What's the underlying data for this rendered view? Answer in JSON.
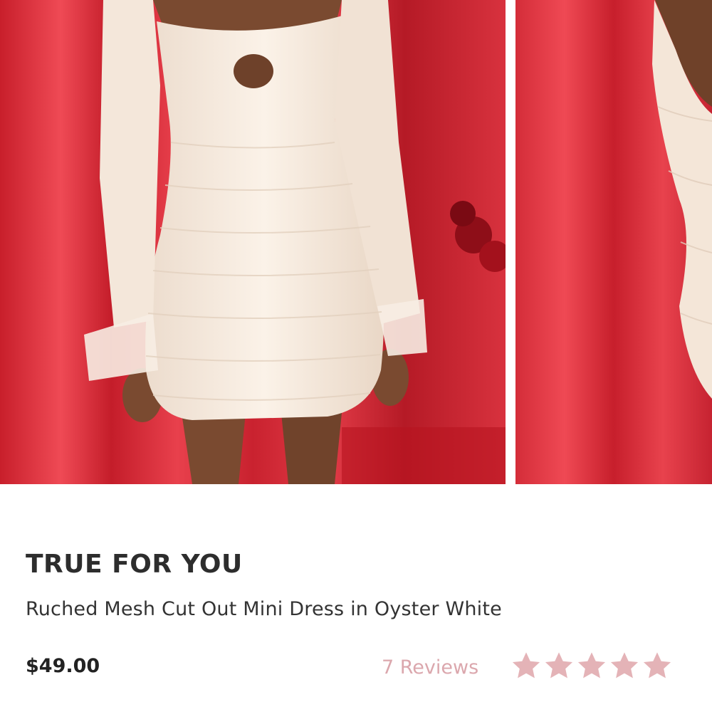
{
  "gallery": {
    "images": [
      {
        "alt_name": "front view of dress"
      },
      {
        "alt_name": "back view of dress"
      }
    ]
  },
  "product": {
    "brand": "TRUE FOR YOU",
    "name": "Ruched Mesh Cut Out Mini Dress in Oyster White",
    "price": "$49.00",
    "reviews_label": "7 Reviews",
    "rating": 5,
    "rating_max": 5
  },
  "colors": {
    "accent": "#dba7ad",
    "star": "#e4b3b7",
    "backdrop_red": "#d9333f",
    "dress": "#f7ece1"
  }
}
